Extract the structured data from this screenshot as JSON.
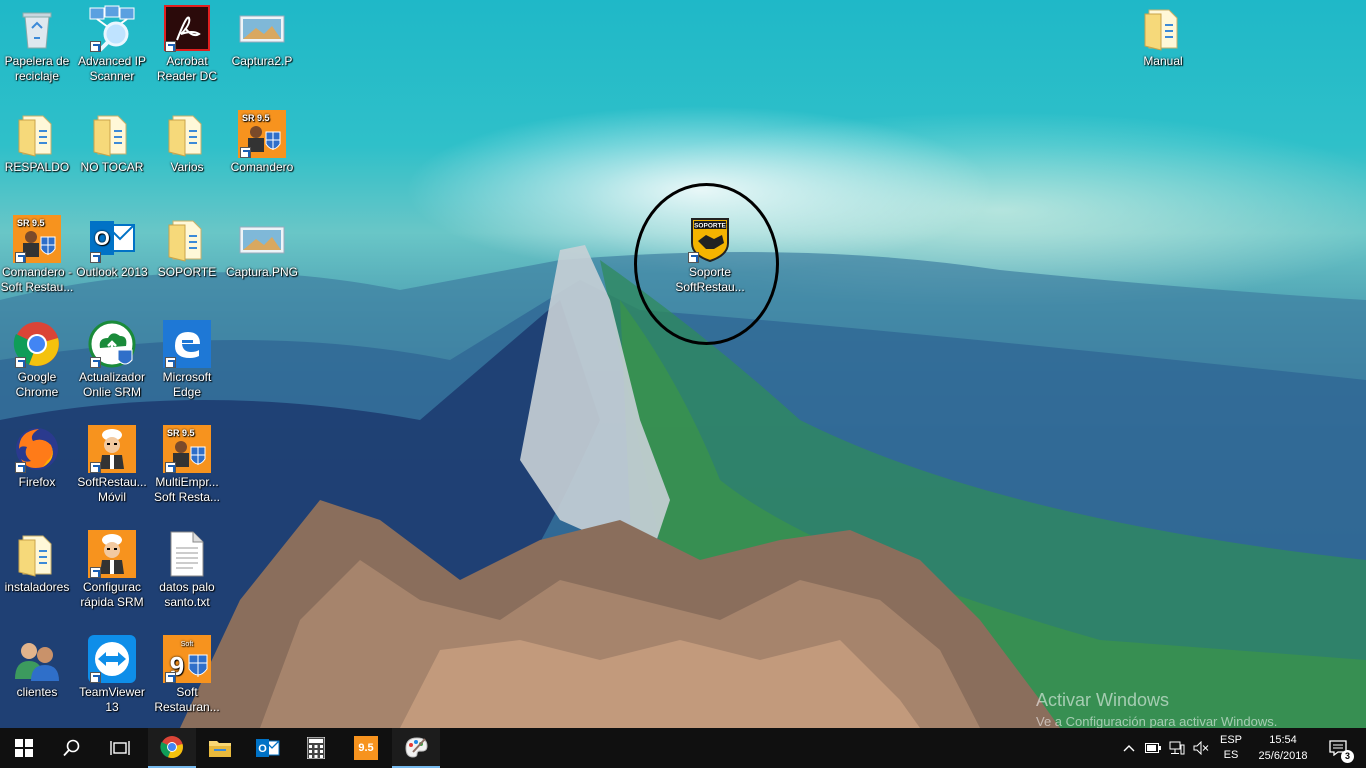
{
  "desktop": {
    "icons": [
      {
        "label": "Papelera de reciclaje",
        "icon": "recycle-bin-icon"
      },
      {
        "label": "Advanced IP Scanner",
        "icon": "network-scanner-icon"
      },
      {
        "label": "Acrobat Reader DC",
        "icon": "acrobat-icon"
      },
      {
        "label": "Captura2.P",
        "icon": "image-file-icon"
      },
      {
        "label": "RESPALDO",
        "icon": "folder-icon"
      },
      {
        "label": "NO TOCAR",
        "icon": "folder-icon"
      },
      {
        "label": "Varios",
        "icon": "folder-icon"
      },
      {
        "label": "Comandero",
        "icon": "sr-app-icon"
      },
      {
        "label": "Comandero - Soft Restau...",
        "icon": "sr-app-icon"
      },
      {
        "label": "Outlook 2013",
        "icon": "outlook-icon"
      },
      {
        "label": "SOPORTE",
        "icon": "folder-icon"
      },
      {
        "label": "Captura.PNG",
        "icon": "image-file-icon"
      },
      {
        "label": "Google Chrome",
        "icon": "chrome-icon"
      },
      {
        "label": "Actualizador Onlie SRM",
        "icon": "cloud-update-icon"
      },
      {
        "label": "Microsoft Edge",
        "icon": "edge-icon"
      },
      {
        "label": "Firefox",
        "icon": "firefox-icon"
      },
      {
        "label": "SoftRestau... Móvil",
        "icon": "chef-icon"
      },
      {
        "label": "MultiEmpr... Soft Resta...",
        "icon": "sr-app-icon"
      },
      {
        "label": "instaladores",
        "icon": "folder-icon"
      },
      {
        "label": "Configurac rápida SRM",
        "icon": "chef-icon"
      },
      {
        "label": "datos palo santo.txt",
        "icon": "text-file-icon"
      },
      {
        "label": "clientes",
        "icon": "users-icon"
      },
      {
        "label": "TeamViewer 13",
        "icon": "teamviewer-icon"
      },
      {
        "label": "Soft Restauran...",
        "icon": "sr9-icon"
      },
      {
        "label": "Manual",
        "icon": "folder-icon"
      },
      {
        "label": "Soporte SoftRestau...",
        "icon": "soporte-badge-icon"
      }
    ],
    "sr_badge_text": "SR 9.5",
    "soporte_badge_text": "SOPORTE",
    "watermark": {
      "title": "Activar Windows",
      "subtitle": "Ve a Configuración para activar Windows."
    }
  },
  "taskbar": {
    "start_icon": "windows-logo-icon",
    "search_icon": "search-icon",
    "taskview_icon": "task-view-icon",
    "pinned": [
      {
        "name": "chrome",
        "icon": "chrome-icon",
        "running": true
      },
      {
        "name": "file-explorer",
        "icon": "file-explorer-icon",
        "running": false
      },
      {
        "name": "outlook",
        "icon": "outlook-icon",
        "running": false
      },
      {
        "name": "calculator",
        "icon": "calculator-icon",
        "running": false
      },
      {
        "name": "soft-restaurant",
        "icon": "sr-taskbar-icon",
        "running": false,
        "badge": "9.5"
      },
      {
        "name": "paint",
        "icon": "paint-icon",
        "running": true
      }
    ],
    "tray": {
      "lang_top": "ESP",
      "lang_bottom": "ES",
      "time": "15:54",
      "date": "25/6/2018",
      "notifications": "3"
    }
  },
  "colors": {
    "taskbar_bg": "#101010",
    "accent": "#76b9ed",
    "sr_orange": "#f7931e"
  }
}
